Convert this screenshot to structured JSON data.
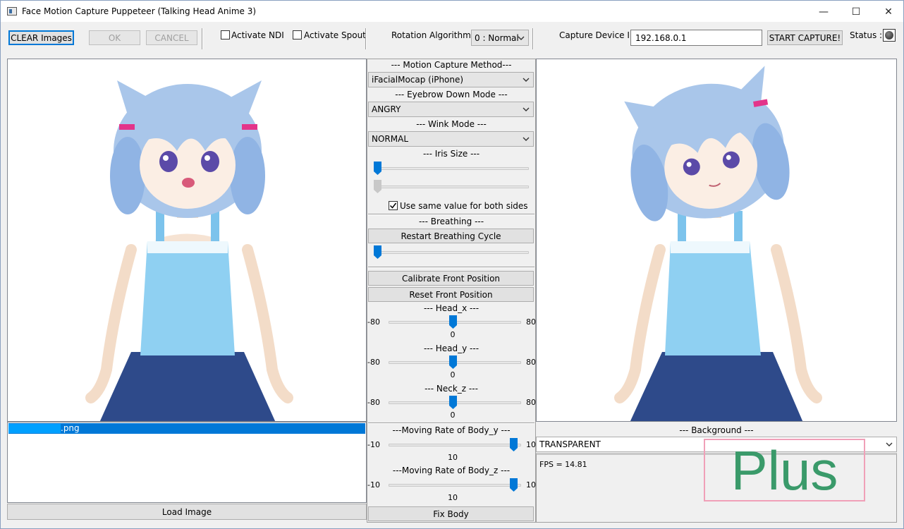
{
  "window": {
    "title": "Face Motion Capture Puppeteer (Talking Head Anime 3)",
    "minimize": "—",
    "maximize": "☐",
    "close": "✕"
  },
  "toolbar": {
    "clear_images": "CLEAR Images",
    "ok": "OK",
    "cancel": "CANCEL",
    "activate_ndi": "Activate NDI",
    "activate_spout": "Activate Spout",
    "rotation_algorithm_label": "Rotation Algorithm",
    "rotation_algorithm_value": "0 : Normal",
    "capture_ip_label": "Capture Device IP:",
    "capture_ip_value": "192.168.0.1",
    "start_capture": "START CAPTURE!",
    "status_label": "Status :"
  },
  "left": {
    "file_name": ".png",
    "load_image": "Load Image"
  },
  "controls": {
    "motion_capture_method": {
      "header": "--- Motion Capture Method---",
      "value": "iFacialMocap (iPhone)"
    },
    "eyebrow_down_mode": {
      "header": "--- Eyebrow Down Mode ---",
      "value": "ANGRY"
    },
    "wink_mode": {
      "header": "--- Wink Mode ---",
      "value": "NORMAL"
    },
    "iris_size": {
      "header": "--- Iris Size ---",
      "left_level": 0.0,
      "right_level": 0.0,
      "same_value_label": "Use same value for both sides",
      "same_value_checked": true
    },
    "breathing": {
      "header": "--- Breathing ---",
      "restart_label": "Restart Breathing Cycle",
      "level": 0.0
    },
    "calibrate_front": "Calibrate Front Position",
    "reset_front": "Reset Front Position",
    "head_x": {
      "header": "--- Head_x ---",
      "min": "-80",
      "max": "80",
      "value": "0"
    },
    "head_y": {
      "header": "--- Head_y ---",
      "min": "-80",
      "max": "80",
      "value": "0"
    },
    "neck_z": {
      "header": "--- Neck_z ---",
      "min": "-80",
      "max": "80",
      "value": "0"
    },
    "body_y": {
      "header": "---Moving Rate of Body_y ---",
      "min": "-10",
      "max": "10",
      "value": "10"
    },
    "body_z": {
      "header": "---Moving Rate of Body_z ---",
      "min": "-10",
      "max": "10",
      "value": "10"
    },
    "fix_body": "Fix Body"
  },
  "right": {
    "background_header": "--- Background ---",
    "background_value": "TRANSPARENT",
    "fps": "FPS = 14.81",
    "watermark": "Plus"
  },
  "colors": {
    "accent": "#0078d7",
    "watermark_text": "#3a9a6a",
    "watermark_border": "#f0a0b8",
    "hair": "#a9c6ea",
    "dress_top": "#8fd0f2",
    "skirt": "#2e4a8a"
  },
  "icons": {
    "status": "status-indicator-icon",
    "dropdown": "chevron-down-icon",
    "app": "app-window-icon"
  }
}
